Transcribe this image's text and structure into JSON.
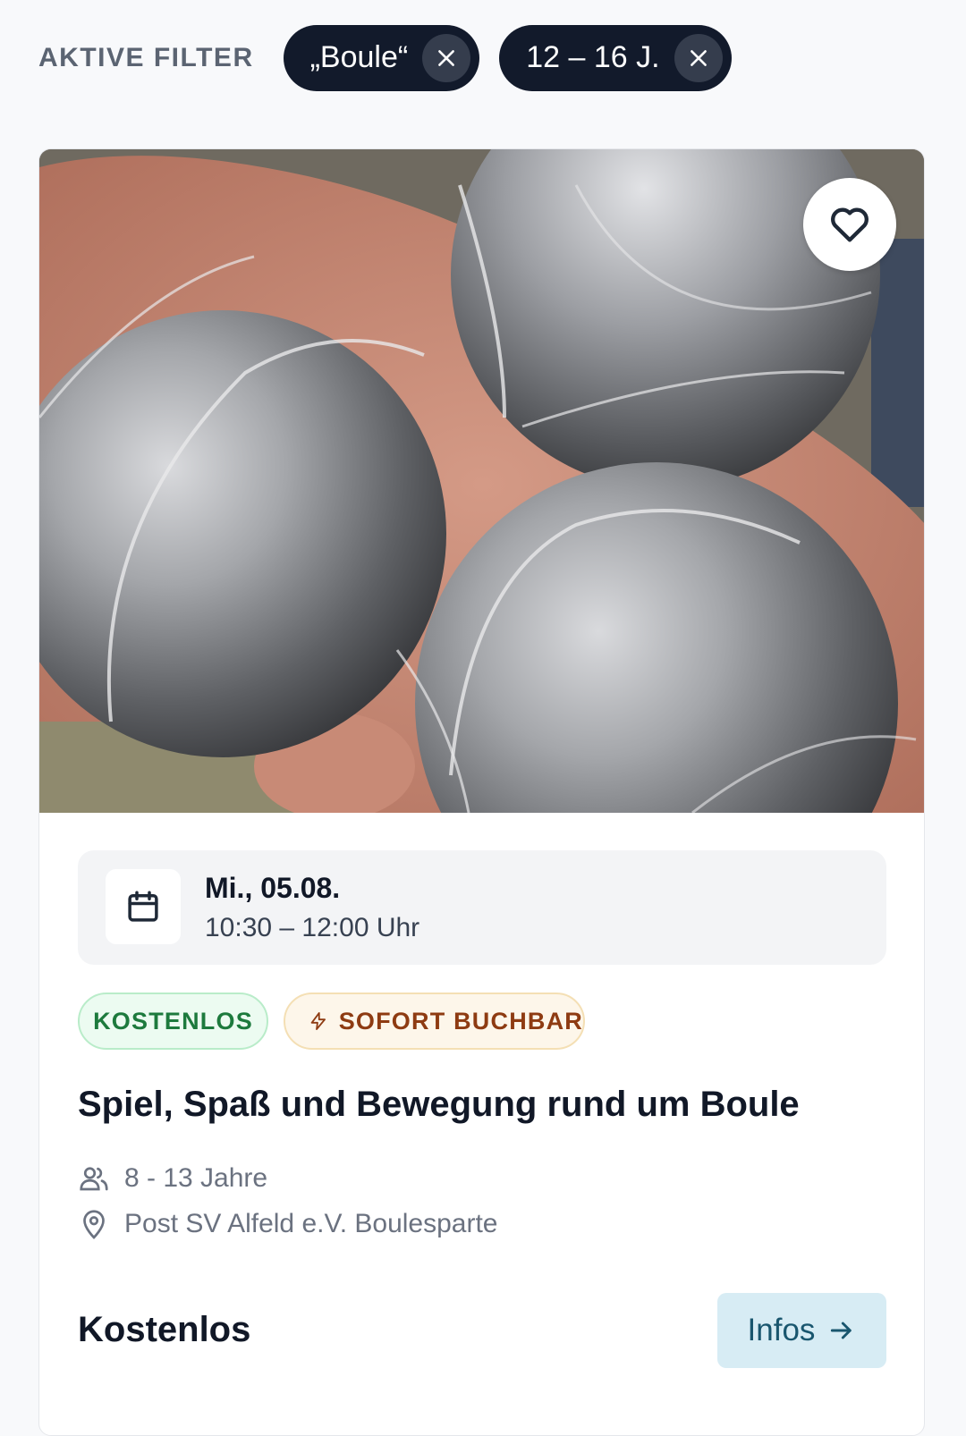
{
  "filters": {
    "label": "AKTIVE FILTER",
    "chips": [
      {
        "label": "„Boule“",
        "icon": "close-icon"
      },
      {
        "label": "12 – 16 J.",
        "icon": "close-icon"
      }
    ]
  },
  "event": {
    "image_alt": "Drei Boule-Kugeln in einer Hand",
    "favorite_icon": "heart-icon",
    "date": {
      "icon": "calendar-icon",
      "day": "Mi., 05.08.",
      "time": "10:30 – 12:00 Uhr"
    },
    "badges": {
      "free": "KOSTENLOS",
      "instant": "SOFORT BUCHBAR",
      "instant_icon": "lightning-icon"
    },
    "title": "Spiel, Spaß und Bewegung rund um Boule",
    "age": {
      "icon": "users-icon",
      "text": "8 - 13 Jahre"
    },
    "location": {
      "icon": "map-pin-icon",
      "text": "Post SV Alfeld e.V. Boulesparte"
    },
    "price": "Kostenlos",
    "cta": {
      "label": "Infos",
      "icon": "arrow-right-icon"
    }
  },
  "colors": {
    "chip_bg": "#121a2b",
    "free_badge_text": "#1d7a3d",
    "instant_badge_text": "#8e3b12",
    "cta_bg": "#d7ecf4",
    "cta_text": "#19566e"
  }
}
